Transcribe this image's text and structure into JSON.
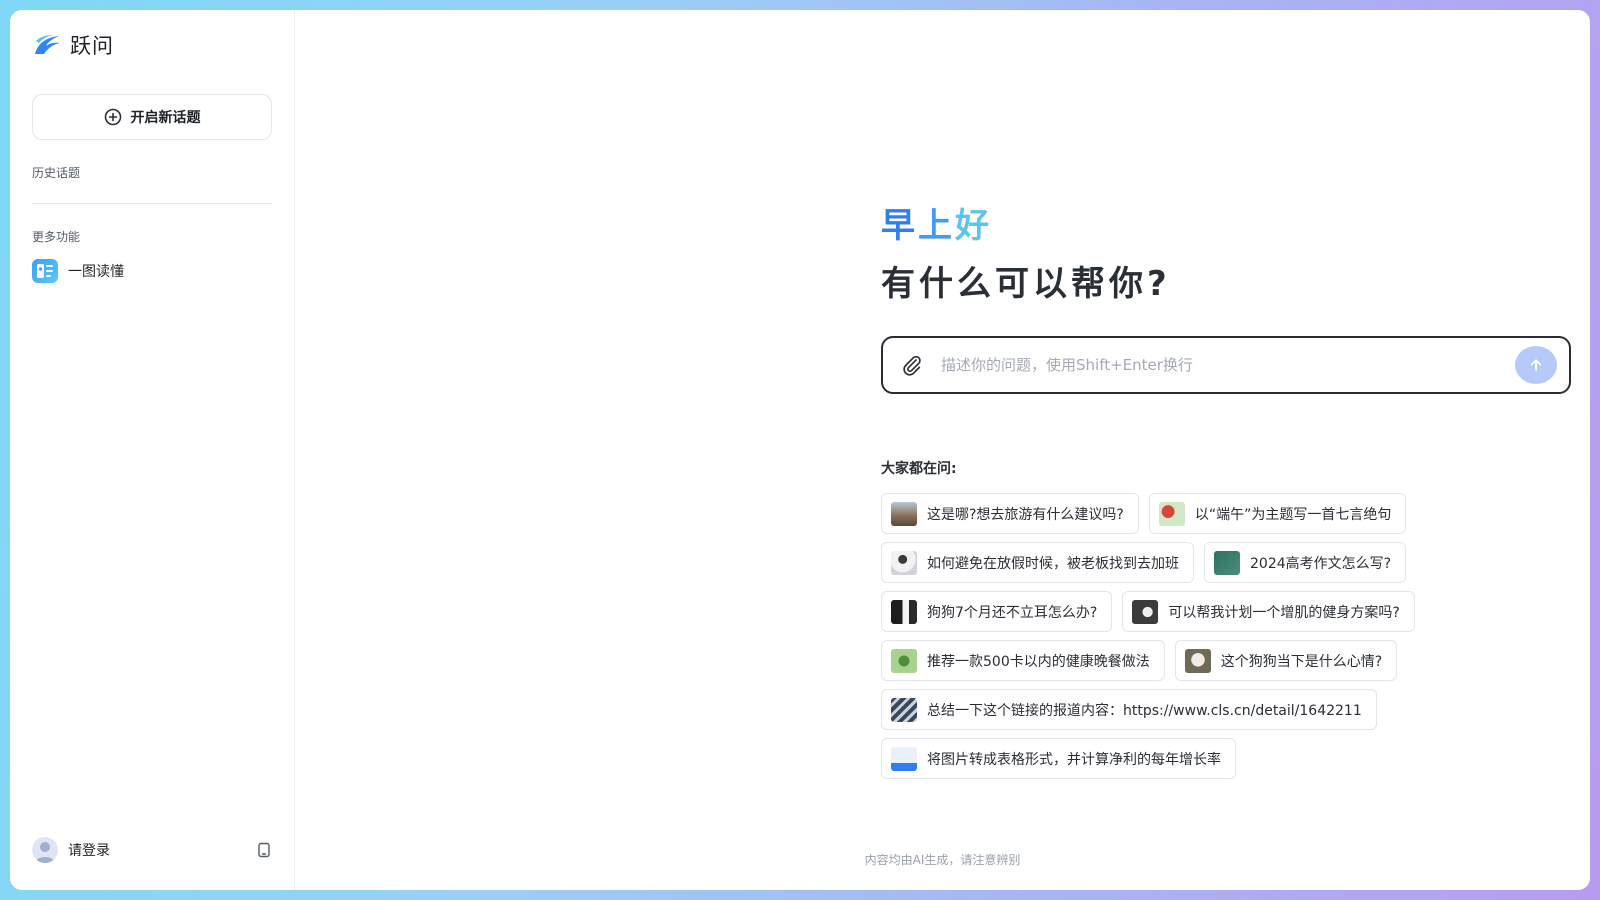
{
  "app": {
    "name": "跃问"
  },
  "sidebar": {
    "new_topic_label": "开启新话题",
    "history_label": "历史话题",
    "more_label": "更多功能",
    "features": [
      {
        "label": "一图读懂",
        "icon": "image-read-icon"
      }
    ],
    "login_label": "请登录"
  },
  "main": {
    "greeting_chars": [
      "早",
      "上",
      "好"
    ],
    "subtitle": "有什么可以帮你?",
    "input": {
      "placeholder": "描述你的问题，使用Shift+Enter换行",
      "value": ""
    },
    "ask_label": "大家都在问:",
    "suggestions": [
      [
        "这是哪?想去旅游有什么建议吗?",
        "以“端午”为主题写一首七言绝句"
      ],
      [
        "如何避免在放假时候，被老板找到去加班",
        "2024高考作文怎么写?"
      ],
      [
        "狗狗7个月还不立耳怎么办?",
        "可以帮我计划一个增肌的健身方案吗?"
      ],
      [
        "推荐一款500卡以内的健康晚餐做法",
        "这个狗狗当下是什么心情?"
      ],
      [
        "总结一下这个链接的报道内容：https://www.cls.cn/detail/1642211"
      ],
      [
        "将图片转成表格形式，并计算净利的每年增长率"
      ]
    ],
    "footer": "内容均由AI生成，请注意辨别"
  },
  "colors": {
    "accent": "#2f7ff0",
    "send_button": "#b6c9fb",
    "input_border": "#2a2e35"
  }
}
